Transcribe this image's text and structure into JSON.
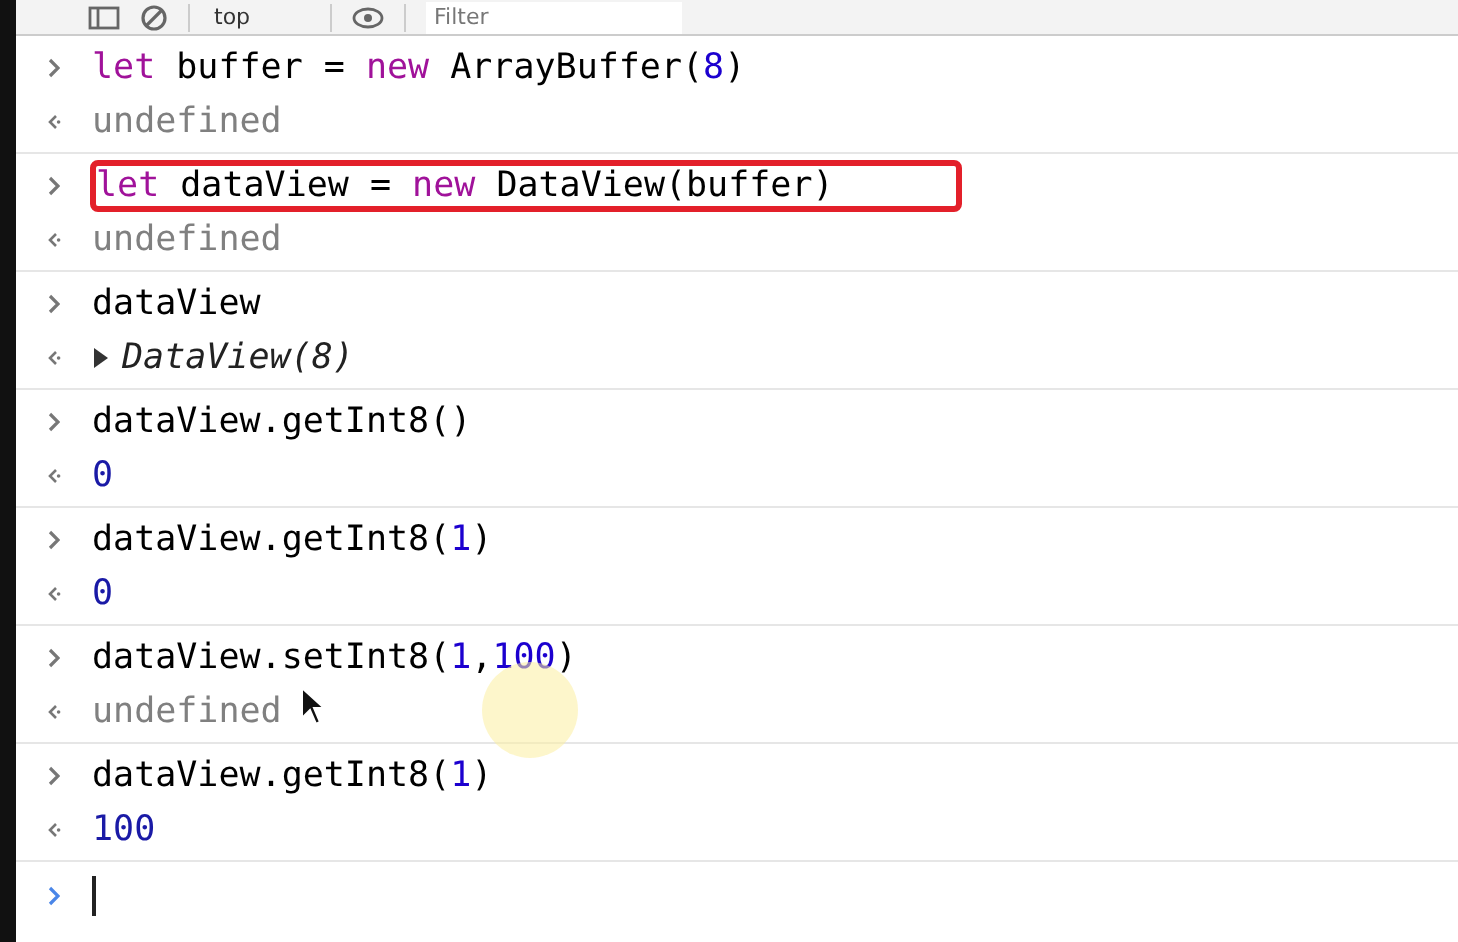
{
  "toolbar": {
    "context": "top",
    "filter": {
      "placeholder": "Filter"
    }
  },
  "entries": [
    {
      "highlighted": false,
      "input": [
        {
          "text": "let",
          "kind": "keyword"
        },
        {
          "text": " buffer = ",
          "kind": "plain"
        },
        {
          "text": "new",
          "kind": "keyword"
        },
        {
          "text": " ArrayBuffer(",
          "kind": "plain"
        },
        {
          "text": "8",
          "kind": "number"
        },
        {
          "text": ")",
          "kind": "plain"
        }
      ],
      "output": {
        "kind": "undefined",
        "text": "undefined"
      }
    },
    {
      "highlighted": true,
      "input": [
        {
          "text": "let",
          "kind": "keyword"
        },
        {
          "text": " dataView = ",
          "kind": "plain"
        },
        {
          "text": "new",
          "kind": "keyword"
        },
        {
          "text": " DataView(buffer)",
          "kind": "plain"
        }
      ],
      "output": {
        "kind": "undefined",
        "text": "undefined"
      }
    },
    {
      "highlighted": false,
      "input": [
        {
          "text": "dataView",
          "kind": "plain"
        }
      ],
      "output": {
        "kind": "object",
        "text": "DataView(8)",
        "expanded": false
      }
    },
    {
      "highlighted": false,
      "input": [
        {
          "text": "dataView.getInt8()",
          "kind": "plain"
        }
      ],
      "output": {
        "kind": "number",
        "text": "0"
      }
    },
    {
      "highlighted": false,
      "input": [
        {
          "text": "dataView.getInt8(",
          "kind": "plain"
        },
        {
          "text": "1",
          "kind": "number"
        },
        {
          "text": ")",
          "kind": "plain"
        }
      ],
      "output": {
        "kind": "number",
        "text": "0"
      }
    },
    {
      "highlighted": false,
      "input": [
        {
          "text": "dataView.setInt8(",
          "kind": "plain"
        },
        {
          "text": "1",
          "kind": "number"
        },
        {
          "text": ",",
          "kind": "plain"
        },
        {
          "text": "100",
          "kind": "number"
        },
        {
          "text": ")",
          "kind": "plain"
        }
      ],
      "output": {
        "kind": "undefined",
        "text": "undefined"
      }
    },
    {
      "highlighted": false,
      "input": [
        {
          "text": "dataView.getInt8(",
          "kind": "plain"
        },
        {
          "text": "1",
          "kind": "number"
        },
        {
          "text": ")",
          "kind": "plain"
        }
      ],
      "output": {
        "kind": "number",
        "text": "100"
      }
    }
  ]
}
